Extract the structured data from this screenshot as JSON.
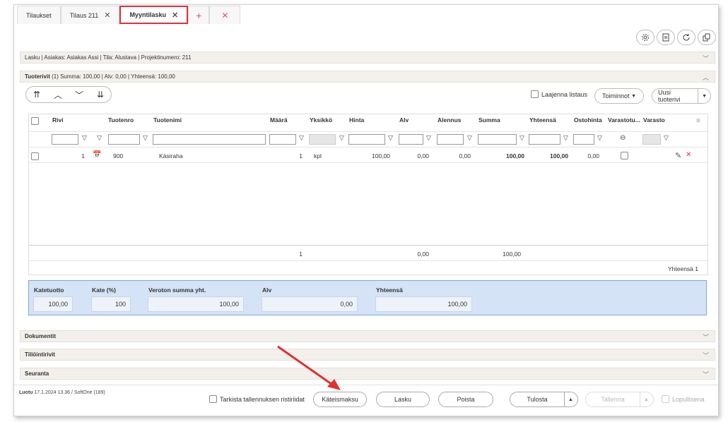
{
  "tabs": [
    {
      "label": "Tilaukset",
      "closable": false
    },
    {
      "label": "Tilaus 211",
      "closable": true
    },
    {
      "label": "Myyntilasku",
      "closable": true,
      "active": true
    }
  ],
  "tab_plus": "+",
  "tab_close": "✕",
  "invoice_header": "Lasku | Asiakas: Asiakas Assi | Tila: Alustava | Projektinumero: 211",
  "rows_header": {
    "title": "Tuoterivit",
    "summary": "(1) Summa: 100,00 | Alv: 0,00 | Yhteensä: 100,00"
  },
  "toolbar": {
    "expand_label": "Laajenna listaus",
    "actions_label": "Toiminnot",
    "new_row_label": "Uusi tuoterivi"
  },
  "columns": [
    "Rivi",
    "Tuotenro",
    "Tuotenimi",
    "Määrä",
    "Yksikkö",
    "Hinta",
    "Alv",
    "Alennus",
    "Summa",
    "Yhteensä",
    "Ostohinta",
    "Varastotu...",
    "Varasto"
  ],
  "rows": [
    {
      "rivi": "1",
      "tuotenro": "900",
      "tuotenimi": "Käsiraha",
      "maara": "1",
      "yksikko": "kpl",
      "hinta": "100,00",
      "alv": "0,00",
      "alennus": "0,00",
      "summa": "100,00",
      "yhteensa": "100,00",
      "ostohinta": "0,00"
    }
  ],
  "totals": {
    "maara": "1",
    "alv": "0,00",
    "summa": "100,00"
  },
  "row_count": "Yhteensä 1",
  "summary": {
    "katetuotto_label": "Katetuotto",
    "katetuotto": "100,00",
    "kate_label": "Kate (%)",
    "kate": "100",
    "veroton_label": "Veroton summa yht.",
    "veroton": "100,00",
    "alv_label": "Alv",
    "alv": "0,00",
    "yhteensa_label": "Yhteensä",
    "yhteensa": "100,00"
  },
  "sections": [
    "Dokumentit",
    "Tiliöintirivit",
    "Seuranta"
  ],
  "footer": {
    "created_label": "Luotu",
    "created_value": "17.1.2024 13.36 / SoftOne (189)",
    "check_label": "Tarkista tallennuksen ristiriidat",
    "cash_button": "Käteismaksu",
    "invoice_button": "Lasku",
    "delete_button": "Poista",
    "print_button": "Tulosta",
    "save_button": "Tallenna",
    "final_label": "Lopullisena"
  },
  "accent_color": "#d9333f",
  "summary_bg": "#d4e3f6"
}
